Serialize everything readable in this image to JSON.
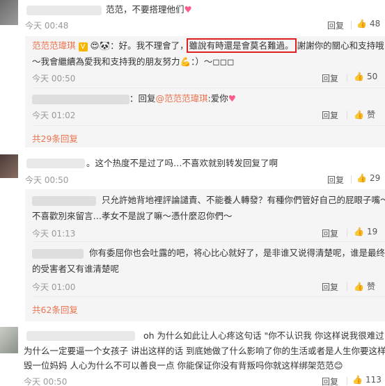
{
  "c1": {
    "text": "范范，不要搭理他们",
    "time": "今天 00:48",
    "reply": "回复",
    "likes": "48"
  },
  "c2": {
    "name": "范范范瑋琪",
    "text_a": "：好。我不理會了，",
    "highlight": "雖說有時還是會莫名難過。",
    "text_b": "謝謝你的關心和支持哦",
    "line2": "～我會繼續為愛我和支持我的朋友努力",
    "line2_end": "：）～◻◻◻",
    "time": "今天 00:50",
    "reply": "回复",
    "likes": "50"
  },
  "c2r1": {
    "text": "：回复",
    "mention": "@范范范瑋琪",
    "text_b": ":爱你",
    "time": "今天 01:02",
    "reply": "回复",
    "likes": "赞"
  },
  "c2_more": "共29条回复",
  "c3": {
    "text": "。这个热度不是过了吗…不喜欢就别转发回复了啊",
    "time": "今天 00:50",
    "reply": "回复",
    "likes": "29"
  },
  "c3r1": {
    "line1": "只允許她背地裡評論譴責、不能養人轉發？有種你們管好自己的屁眼子嘴～",
    "line2": "不喜歡別來留言…孝女不是說了嘛～憑什麼忍你們～",
    "time": "今天 01:13",
    "reply": "回复",
    "likes": "19"
  },
  "c3r2": {
    "line1": "你有委屈你也会吐露的吧，将心比心就好了，是非谁又说得清楚呢，谁是最终",
    "line2": "的受害者又有谁清楚呢",
    "time": "今天 01:00",
    "reply": "回复",
    "likes": "赞"
  },
  "c3_more": "共62条回复",
  "c4": {
    "line1": "oh 为什么如此让人心疼这句话 \"你不认识我 你这样说我很难过\"",
    "line2": "为什么一定要逼一个女孩子 讲出这样的话 到底她做了什么影响了你的生活或者是人生你要这样诋",
    "line3": "毁一位妈妈 人心为什么不可以善良一点 你能保证你没有背叛吗你就这样绑架范范",
    "time": "今天 00:50",
    "reply": "回复",
    "likes": "113"
  },
  "colors": {
    "link": "#eb7350",
    "highlight_box": "#e02020",
    "time": "#999999",
    "bg_reply": "#f5f5f5"
  },
  "icons": [
    "thumb-up-icon",
    "heart-emoji-icon",
    "verified-icon",
    "reply-icon"
  ]
}
